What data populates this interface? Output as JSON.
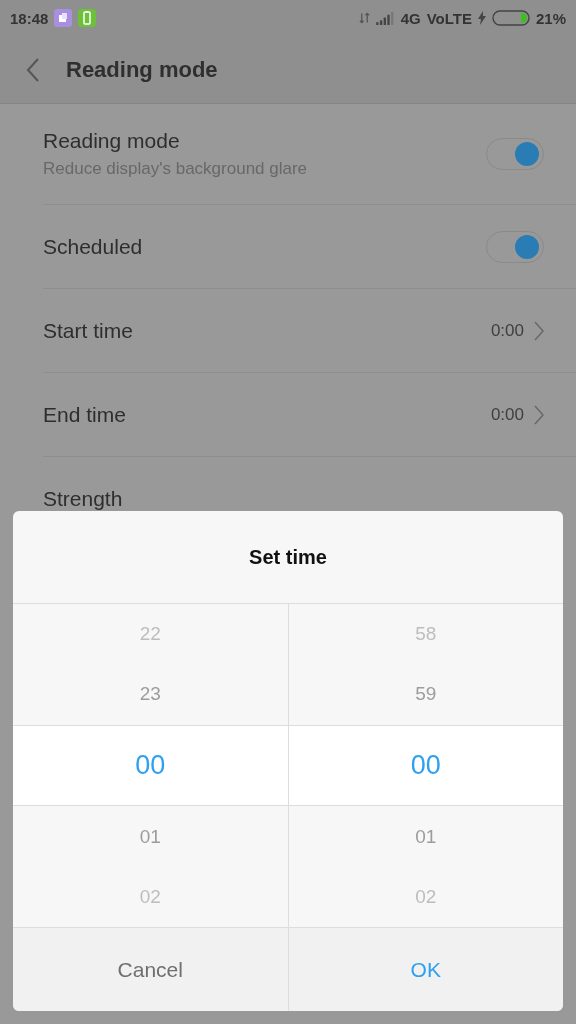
{
  "status_bar": {
    "time": "18:48",
    "network": "4G",
    "volte": "VoLTE",
    "battery": "21%"
  },
  "header": {
    "title": "Reading mode"
  },
  "settings": [
    {
      "kind": "toggle",
      "label": "Reading mode",
      "subtitle": "Reduce display's background glare",
      "on": true
    },
    {
      "kind": "toggle",
      "label": "Scheduled",
      "on": true
    },
    {
      "kind": "link",
      "label": "Start time",
      "value": "0:00"
    },
    {
      "kind": "link",
      "label": "End time",
      "value": "0:00"
    },
    {
      "kind": "plain",
      "label": "Strength"
    }
  ],
  "dialog": {
    "title": "Set time",
    "columns": [
      {
        "items": [
          {
            "text": "22",
            "selected": false
          },
          {
            "text": "23",
            "selected": false
          },
          {
            "text": "00",
            "selected": true
          },
          {
            "text": "01",
            "selected": false
          },
          {
            "text": "02",
            "selected": false
          }
        ]
      },
      {
        "items": [
          {
            "text": "58",
            "selected": false
          },
          {
            "text": "59",
            "selected": false
          },
          {
            "text": "00",
            "selected": true
          },
          {
            "text": "01",
            "selected": false
          },
          {
            "text": "02",
            "selected": false
          }
        ]
      }
    ],
    "buttons": [
      {
        "label": "Cancel",
        "kind": "cancel"
      },
      {
        "label": "OK",
        "kind": "confirm"
      }
    ]
  }
}
